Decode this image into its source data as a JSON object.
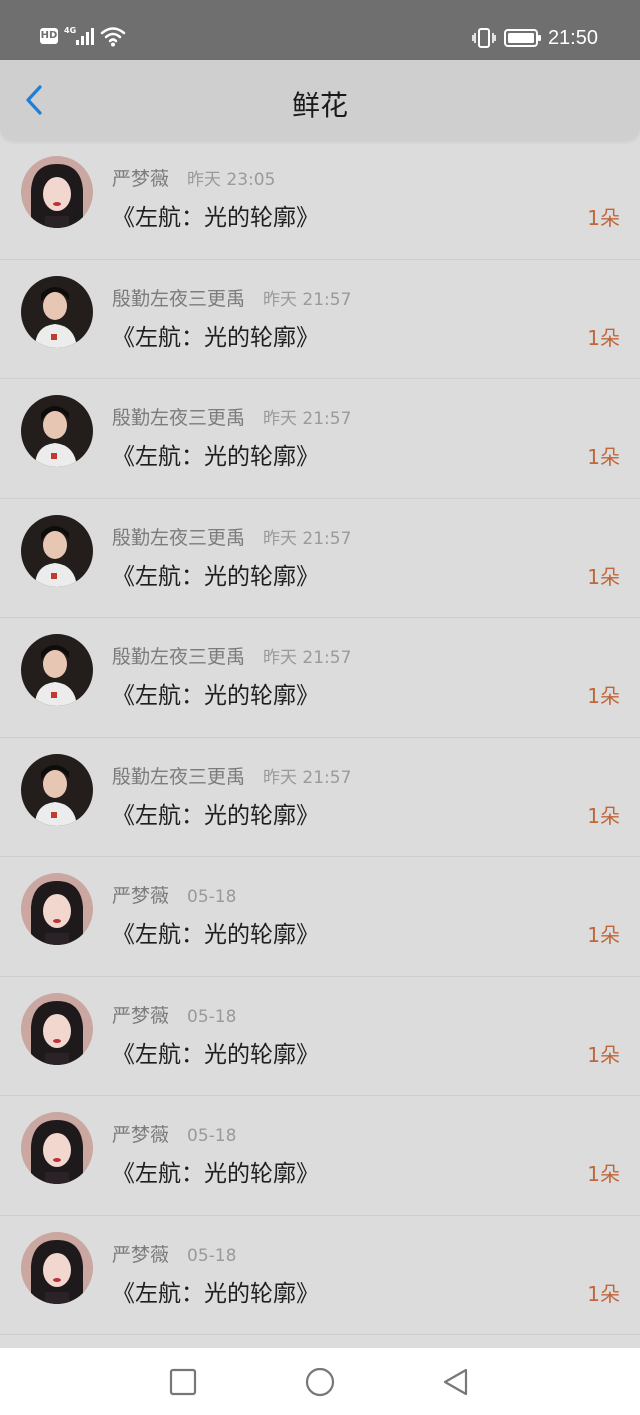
{
  "status_bar": {
    "hd": "HD",
    "network": "4G",
    "time": "21:50",
    "icons": [
      "signal-icon",
      "wifi-icon",
      "vibrate-icon",
      "battery-icon"
    ]
  },
  "header": {
    "title": "鲜花",
    "back_icon": "chevron-left-icon"
  },
  "colors": {
    "accent": "#1e7fd6",
    "count": "#c0663a",
    "background": "#dcdcdc"
  },
  "rows": [
    {
      "user": "严梦薇",
      "time": "昨天 23:05",
      "book": "《左航：光的轮廓》",
      "count": "1朵",
      "avatar": "girl"
    },
    {
      "user": "殷勤左夜三更禹",
      "time": "昨天 21:57",
      "book": "《左航：光的轮廓》",
      "count": "1朵",
      "avatar": "boy"
    },
    {
      "user": "殷勤左夜三更禹",
      "time": "昨天 21:57",
      "book": "《左航：光的轮廓》",
      "count": "1朵",
      "avatar": "boy"
    },
    {
      "user": "殷勤左夜三更禹",
      "time": "昨天 21:57",
      "book": "《左航：光的轮廓》",
      "count": "1朵",
      "avatar": "boy"
    },
    {
      "user": "殷勤左夜三更禹",
      "time": "昨天 21:57",
      "book": "《左航：光的轮廓》",
      "count": "1朵",
      "avatar": "boy"
    },
    {
      "user": "殷勤左夜三更禹",
      "time": "昨天 21:57",
      "book": "《左航：光的轮廓》",
      "count": "1朵",
      "avatar": "boy"
    },
    {
      "user": "严梦薇",
      "time": "05-18",
      "book": "《左航：光的轮廓》",
      "count": "1朵",
      "avatar": "girl"
    },
    {
      "user": "严梦薇",
      "time": "05-18",
      "book": "《左航：光的轮廓》",
      "count": "1朵",
      "avatar": "girl"
    },
    {
      "user": "严梦薇",
      "time": "05-18",
      "book": "《左航：光的轮廓》",
      "count": "1朵",
      "avatar": "girl"
    },
    {
      "user": "严梦薇",
      "time": "05-18",
      "book": "《左航：光的轮廓》",
      "count": "1朵",
      "avatar": "girl"
    }
  ],
  "nav_bar": {
    "buttons": [
      "recent-apps-icon",
      "home-icon",
      "back-triangle-icon"
    ]
  }
}
